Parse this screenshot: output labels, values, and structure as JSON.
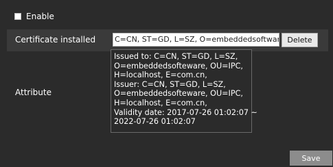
{
  "enable": {
    "label": "Enable",
    "checked": false
  },
  "certificate": {
    "label": "Certificate installed",
    "value": "C=CN, ST=GD, L=SZ, O=embeddedsoftware",
    "delete_label": "Delete"
  },
  "attribute": {
    "label": "Attribute",
    "lines": [
      "Issued to: C=CN, ST=GD, L=SZ,",
      "O=embeddedsofteware, OU=IPC,",
      "H=localhost, E=com.cn,",
      "Issuer: C=CN, ST=GD, L=SZ,",
      "O=embeddedsofteware, OU=IPC,",
      "H=localhost, E=com.cn,",
      "Validity date: 2017-07-26 01:02:07 ~",
      "2022-07-26 01:02:07"
    ]
  },
  "save_label": "Save"
}
